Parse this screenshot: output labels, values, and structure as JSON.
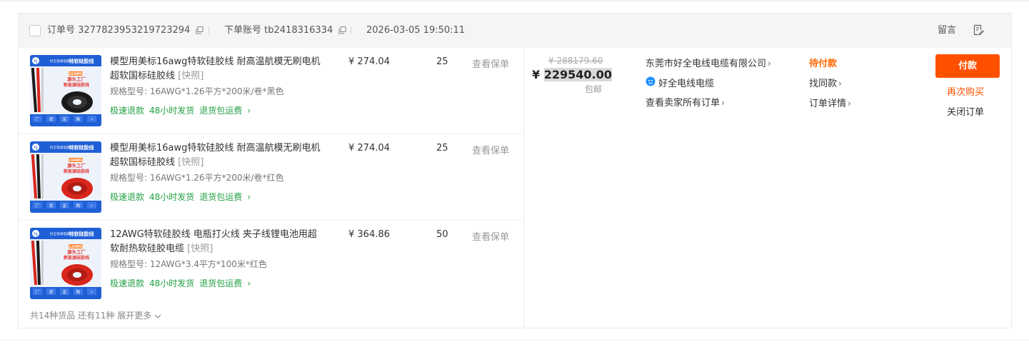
{
  "order": {
    "order_no_label": "订单号",
    "order_no": "3277823953219723294",
    "account_label": "下单账号",
    "account": "tb2418316334",
    "datetime": "2026-03-05 19:50:11",
    "message_label": "留言"
  },
  "items": [
    {
      "title": "模型用美标16awg特软硅胶线 耐高温航模无刷电机超软国标硅胶线",
      "snapshot": "[快照]",
      "spec": "规格型号: 16AWG*1.26平方*200米/卷*黑色",
      "services": [
        "极速退款",
        "48小时发货",
        "退货包运费"
      ],
      "price": "¥ 274.04",
      "qty": "25",
      "view_insurance": "查看保单",
      "thumb": {
        "brand": "好全电线电缆",
        "banner": "特软硅胶线",
        "awg": "16AWG",
        "line1": "源头工厂",
        "line2": "新能源硅胶线",
        "cable_color": "#1a1a1a",
        "icons": [
          "厂",
          "货",
          "定",
          "购",
          "✓"
        ]
      }
    },
    {
      "title": "模型用美标16awg特软硅胶线 耐高温航模无刷电机超软国标硅胶线",
      "snapshot": "[快照]",
      "spec": "规格型号: 16AWG*1.26平方*200米/卷*红色",
      "services": [
        "极速退款",
        "48小时发货",
        "退货包运费"
      ],
      "price": "¥ 274.04",
      "qty": "25",
      "view_insurance": "查看保单",
      "thumb": {
        "brand": "好全电线电缆",
        "banner": "特软硅胶线",
        "awg": "16AWG",
        "line1": "源头工厂",
        "line2": "新能源硅胶线",
        "cable_color": "#d9261c",
        "icons": [
          "厂",
          "货",
          "定",
          "购",
          "✓"
        ]
      }
    },
    {
      "title": "12AWG特软硅胶线 电瓶打火线 夹子线锂电池用超软耐热软硅胶电缆",
      "snapshot": "[快照]",
      "spec": "规格型号: 12AWG*3.4平方*100米*红色",
      "services": [
        "极速退款",
        "48小时发货",
        "退货包运费"
      ],
      "price": "¥ 364.86",
      "qty": "50",
      "view_insurance": "查看保单",
      "thumb": {
        "brand": "好全电线电缆",
        "banner": "特软硅胶线",
        "awg": "12AWG",
        "line1": "源头工厂",
        "line2": "新能源硅胶线",
        "cable_color": "#d9261c",
        "icons": [
          "厂",
          "货",
          "定",
          "购",
          "✓"
        ]
      }
    }
  ],
  "more": {
    "text": "共14种货品 还有11种",
    "expand": "展开更多"
  },
  "totals": {
    "original": "¥ 288179.60",
    "currency": "¥",
    "paid": "229540.00",
    "shipping": "包邮"
  },
  "seller": {
    "shop": "东莞市好全电线电缆有限公司",
    "wangwang": "好全电线电缆",
    "all_orders": "查看卖家所有订单"
  },
  "status": {
    "label": "待付款",
    "find_similar": "找同款",
    "order_detail": "订单详情"
  },
  "actions": {
    "pay": "付款",
    "rebuy": "再次购买",
    "close": "关闭订单"
  },
  "colors": {
    "accent": "#ff5000",
    "status": "#ff6600",
    "service_green": "#22a043",
    "thumb_blue": "#1f5fd6"
  },
  "icons": [
    "copy-icon",
    "note-icon",
    "chevron-right-icon",
    "chevron-down-icon",
    "wangwang-chat-icon",
    "checkbox"
  ]
}
